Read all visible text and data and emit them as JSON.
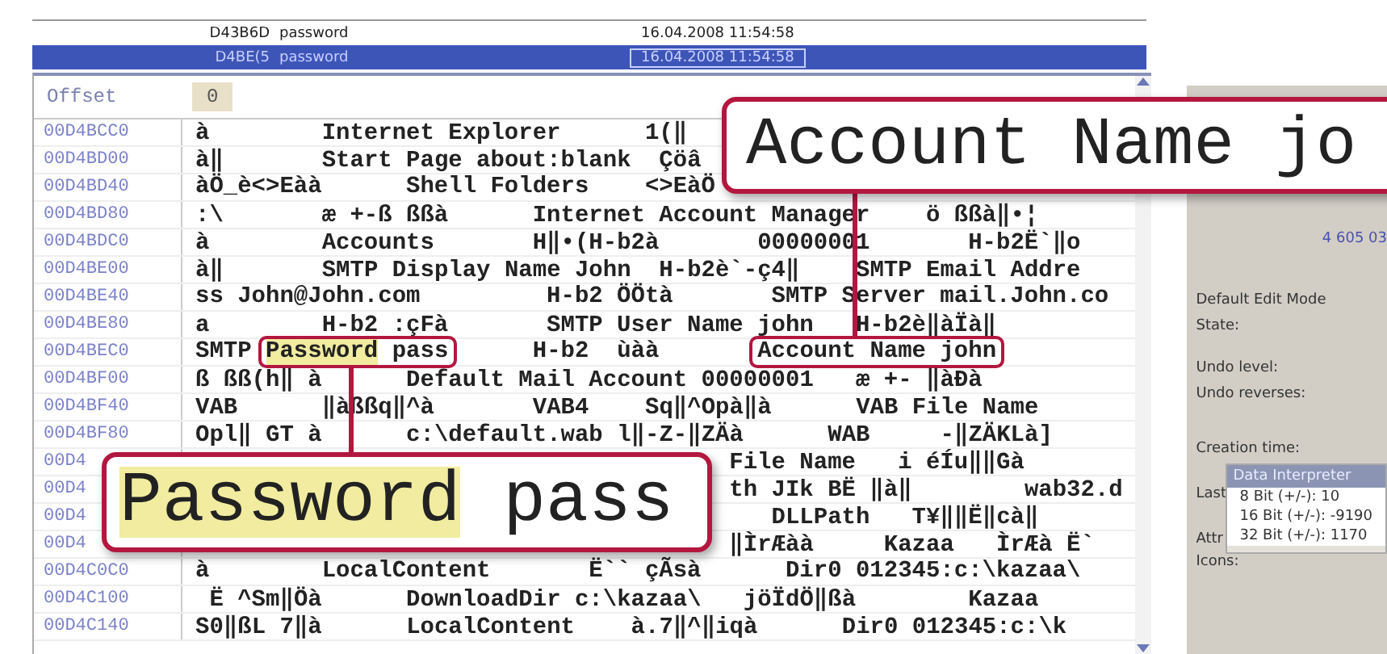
{
  "results": [
    {
      "id": "D43B6D",
      "label": "password",
      "date": "16.04.2008 11:54:58",
      "selected": false
    },
    {
      "id": "D4BE(5",
      "label": "password",
      "date": "16.04.2008 11:54:58",
      "selected": true
    }
  ],
  "hex_view": {
    "offset_header": "Offset",
    "column_tab": "0",
    "rows": [
      {
        "offset": "00D4BCC0",
        "text": "à        Internet Explorer      1(‖"
      },
      {
        "offset": "00D4BD00",
        "text": "à‖       Start Page about:blank  Çöâ"
      },
      {
        "offset": "00D4BD40",
        "text": "àÖ_è<>Eàà      Shell Folders    <>EàÖ"
      },
      {
        "offset": "00D4BD80",
        "text": ":\\       æ +-ß ßßà      Internet Account Manager    ö ßßà‖•¦"
      },
      {
        "offset": "00D4BDC0",
        "text": "à        Accounts       H‖•(H-b2à       00000001       H-b2Ë`‖o"
      },
      {
        "offset": "00D4BE00",
        "text": "à‖       SMTP Display Name John  H-b2è`-ç4‖    SMTP Email Addre"
      },
      {
        "offset": "00D4BE40",
        "text": "ss John@John.com         H-b2 ÖÖtà       SMTP Server mail.John.co"
      },
      {
        "offset": "00D4BE80",
        "text": "a        H-b2 :çFà       SMTP User Name john   H-b2è‖àÏà‖"
      },
      {
        "offset": "00D4BEC0",
        "parts": [
          {
            "kind": "plain",
            "text": "SMTP "
          },
          {
            "kind": "boxed",
            "segments": [
              {
                "text": "Password",
                "highlighted": true
              },
              {
                "text": " pass",
                "highlighted": false
              }
            ]
          },
          {
            "kind": "plain",
            "text": "      H-b2  ùàà       "
          },
          {
            "kind": "boxed",
            "segments": [
              {
                "text": "Account Name john",
                "highlighted": false
              }
            ]
          }
        ]
      },
      {
        "offset": "00D4BF00",
        "text": "ß ßß(h‖ à      Default Mail Account 00000001   æ +- ‖àÐà"
      },
      {
        "offset": "00D4BF40",
        "text": "VAB      ‖àßßq‖^à       VAB4    Sq‖^Opà‖à      VAB File Name"
      },
      {
        "offset": "00D4BF80",
        "text": "Opl‖ GT à      c:\\default.wab l‖-Z-‖ZÄà      WAB     -‖ZÄKLà]"
      },
      {
        "offset": "00D4",
        "text": "                                      File Name   i éÍu‖‖Gà"
      },
      {
        "offset": "00D4",
        "text": "                                      th JIk BË ‖à‖        wab32.d"
      },
      {
        "offset": "00D4",
        "text": "                                         DLLPath   T¥‖‖Ë‖cà‖"
      },
      {
        "offset": "00D4",
        "text": "                                      ‖ÌrÆàà     Kazaa   ÌrÆà Ë`"
      },
      {
        "offset": "00D4C0C0",
        "text": "à        LocalContent       Ë`` çÃsà      Dir0 012345:c:\\kazaa\\"
      },
      {
        "offset": "00D4C100",
        "text": " Ë ^Sm‖Öà      DownloadDir c:\\kazaa\\   jöÏdÖ‖ßà        Kazaa"
      },
      {
        "offset": "00D4C140",
        "text": "S0‖ßL 7‖à      LocalContent    à.7‖^‖iqà      Dir0 012345:c:\\k"
      }
    ]
  },
  "side_panel": {
    "file_size": "4 605 03",
    "labels": [
      "Default Edit Mode",
      "State:",
      "Undo level:",
      "Undo reverses:",
      "Creation time:"
    ],
    "interpreter": {
      "title": "Data Interpreter",
      "lines": [
        "8 Bit (+/-): 10",
        "16 Bit (+/-): -9190",
        "32 Bit (+/-): 1170"
      ]
    },
    "side_labels": [
      "Last",
      "Attr"
    ],
    "icons_label": "Icons:"
  },
  "callouts": [
    {
      "kind": "top",
      "segments": [
        {
          "text": "Account Name jo",
          "highlighted": false
        }
      ]
    },
    {
      "kind": "bottom",
      "segments": [
        {
          "text": "Password",
          "highlighted": true
        },
        {
          "text": " pass",
          "highlighted": false
        }
      ]
    }
  ]
}
